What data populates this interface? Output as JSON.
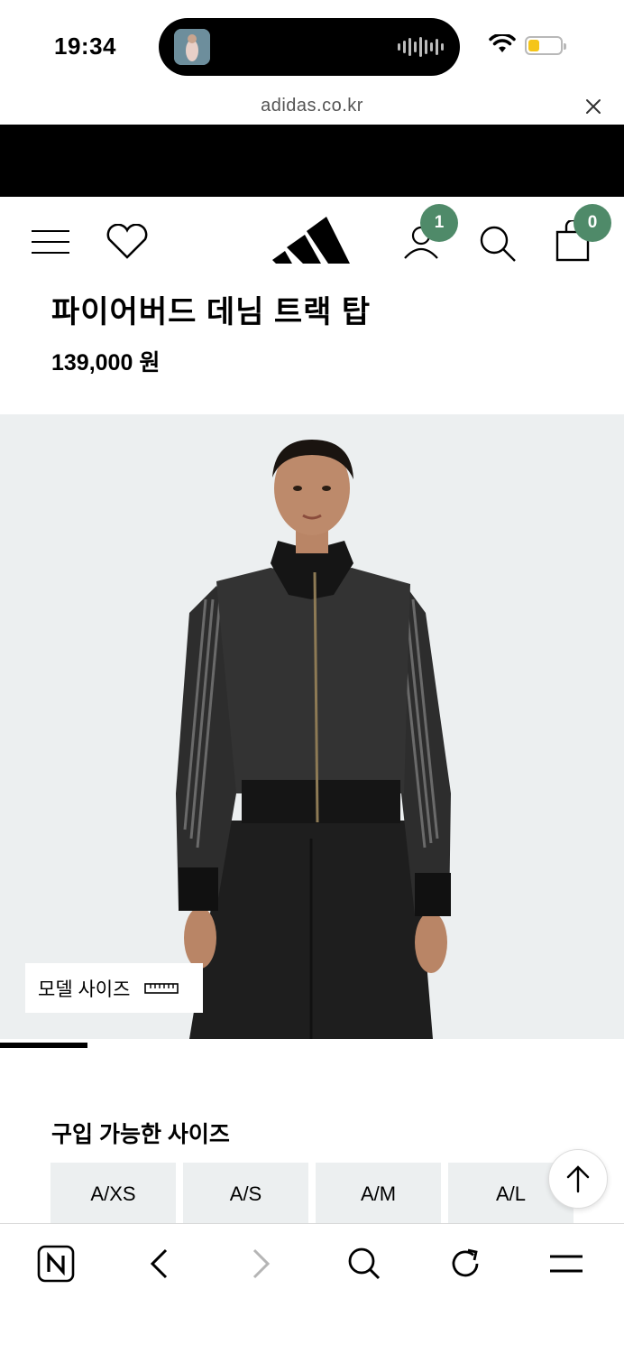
{
  "status_bar": {
    "time": "19:34"
  },
  "browser": {
    "url": "adidas.co.kr"
  },
  "header": {
    "account_badge": "1",
    "cart_badge": "0",
    "badge_color": "#4f8a69"
  },
  "product": {
    "title": "파이어버드 데님 트랙 탑",
    "price": "139,000 원",
    "model_size_label": "모델 사이즈",
    "gallery_progress": 0.14
  },
  "sizes": {
    "title": "구입 가능한 사이즈",
    "options": [
      "A/XS",
      "A/S",
      "A/M",
      "A/L"
    ]
  },
  "icons": {
    "menu": "hamburger-icon",
    "wishlist": "heart-icon",
    "logo": "adidas-logo",
    "account": "user-icon",
    "search": "search-icon",
    "cart": "shopping-bag-icon",
    "model_size": "ruler-icon",
    "back_to_top": "arrow-up-icon"
  }
}
